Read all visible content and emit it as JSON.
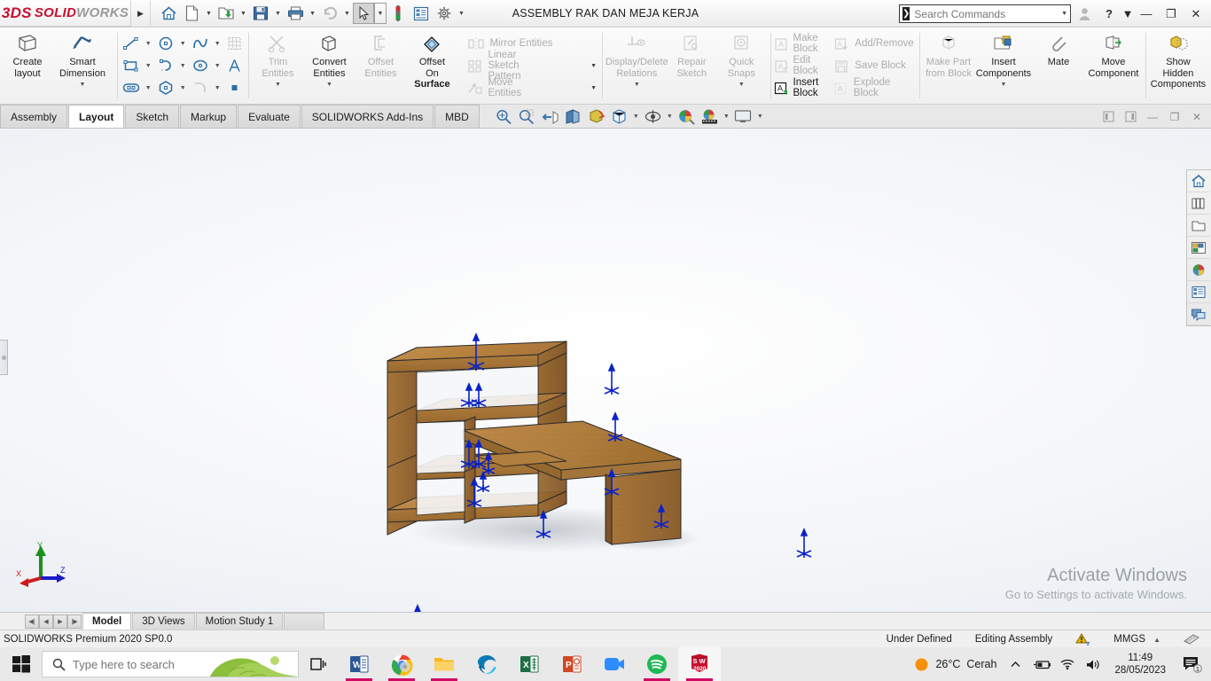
{
  "titlebar": {
    "logo_ds": "3DS",
    "logo_solid": "SOLID",
    "logo_works": "WORKS",
    "document_title": "ASSEMBLY RAK DAN MEJA KERJA",
    "search_placeholder": "Search Commands",
    "icons": [
      "expand-arrow-icon",
      "home-icon",
      "new-document-icon",
      "open-folder-icon",
      "save-icon",
      "print-icon",
      "undo-icon",
      "select-cursor-icon",
      "rebuild-icon",
      "options-list-icon",
      "settings-gear-icon"
    ],
    "window_buttons": [
      "user-account-icon",
      "help-icon",
      "minimize-button",
      "restore-button",
      "close-button"
    ]
  },
  "ribbon": {
    "groups": [
      {
        "name": "layout",
        "buttons": [
          {
            "label": "Create\nlayout",
            "label_l1": "Create",
            "label_l2": "layout",
            "enabled": true,
            "icon": "create-layout-icon"
          },
          {
            "label_l1": "Smart",
            "label_l2": "Dimension",
            "enabled": true,
            "icon": "smart-dimension-icon"
          }
        ]
      },
      {
        "name": "sketch-entities",
        "small_icons": [
          "line-icon",
          "circle-icon",
          "spline-icon",
          "sketch-grid-icon",
          "rectangle-icon",
          "arc-icon",
          "ellipse-icon",
          "text-icon",
          "slot-icon",
          "polygon-icon",
          "fillet-icon",
          "point-icon"
        ]
      },
      {
        "name": "sketch-tools",
        "buttons": [
          {
            "label_l1": "Trim",
            "label_l2": "Entities",
            "enabled": false,
            "icon": "trim-entities-icon"
          },
          {
            "label_l1": "Convert",
            "label_l2": "Entities",
            "enabled": true,
            "icon": "convert-entities-icon"
          },
          {
            "label_l1": "Offset",
            "label_l2": "Entities",
            "enabled": false,
            "icon": "offset-entities-icon"
          },
          {
            "label_l1": "Offset",
            "label_l2": "On",
            "label_l3": "Surface",
            "enabled": true,
            "icon": "offset-on-surface-icon"
          }
        ]
      },
      {
        "name": "pattern-tools",
        "items": [
          {
            "label": "Mirror Entities",
            "enabled": false,
            "icon": "mirror-entities-icon",
            "has_caret": false
          },
          {
            "label": "Linear Sketch Pattern",
            "enabled": false,
            "icon": "linear-sketch-pattern-icon",
            "has_caret": true
          },
          {
            "label": "Move Entities",
            "enabled": false,
            "icon": "move-entities-icon",
            "has_caret": true
          }
        ]
      },
      {
        "name": "relations",
        "buttons": [
          {
            "label_l1": "Display/Delete",
            "label_l2": "Relations",
            "enabled": false,
            "icon": "display-delete-relations-icon"
          },
          {
            "label_l1": "Repair",
            "label_l2": "Sketch",
            "enabled": false,
            "icon": "repair-sketch-icon"
          },
          {
            "label_l1": "Quick",
            "label_l2": "Snaps",
            "enabled": false,
            "icon": "quick-snaps-icon"
          }
        ]
      },
      {
        "name": "blocks",
        "items": [
          {
            "label": "Make Block",
            "enabled": false,
            "icon": "make-block-icon"
          },
          {
            "label": "Edit Block",
            "enabled": false,
            "icon": "edit-block-icon"
          },
          {
            "label": "Insert Block",
            "enabled": true,
            "icon": "insert-block-icon"
          },
          {
            "label": "Add/Remove",
            "enabled": false,
            "icon": "add-remove-block-icon"
          },
          {
            "label": "Save Block",
            "enabled": false,
            "icon": "save-block-icon"
          },
          {
            "label": "Explode Block",
            "enabled": false,
            "icon": "explode-block-icon"
          }
        ]
      },
      {
        "name": "components",
        "buttons": [
          {
            "label_l1": "Make Part",
            "label_l2": "from Block",
            "enabled": false,
            "icon": "make-part-from-block-icon"
          },
          {
            "label_l1": "Insert",
            "label_l2": "Components",
            "enabled": true,
            "icon": "insert-components-icon"
          },
          {
            "label_l1": "Mate",
            "enabled": true,
            "icon": "mate-icon"
          },
          {
            "label_l1": "Move",
            "label_l2": "Component",
            "enabled": true,
            "icon": "move-component-icon"
          },
          {
            "label_l1": "Show",
            "label_l2": "Hidden",
            "label_l3": "Components",
            "enabled": true,
            "icon": "show-hidden-components-icon"
          }
        ]
      }
    ]
  },
  "tabs": {
    "items": [
      {
        "label": "Assembly",
        "active": false
      },
      {
        "label": "Layout",
        "active": true
      },
      {
        "label": "Sketch",
        "active": false
      },
      {
        "label": "Markup",
        "active": false
      },
      {
        "label": "Evaluate",
        "active": false
      },
      {
        "label": "SOLIDWORKS Add-Ins",
        "active": false
      },
      {
        "label": "MBD",
        "active": false
      }
    ],
    "view_tools": [
      "zoom-to-fit-icon",
      "zoom-to-area-icon",
      "previous-view-icon",
      "section-view-icon",
      "view-orientation-icon",
      "display-style-icon",
      "hide-show-items-icon",
      "edit-appearance-icon",
      "apply-scene-icon",
      "view-settings-icon"
    ],
    "doc_controls": [
      "pin-left-icon",
      "pin-right-icon",
      "doc-minimize-button",
      "doc-restore-button",
      "doc-close-button"
    ]
  },
  "graphics": {
    "model_name": "rak-dan-meja-kerja-assembly",
    "watermark_line1": "Activate Windows",
    "watermark_line2": "Go to Settings to activate Windows.",
    "triad_axes": [
      "X",
      "Y",
      "Z"
    ],
    "task_pane_icons": [
      "sw-resources-home-icon",
      "design-library-icon",
      "file-explorer-icon",
      "view-palette-icon",
      "appearances-scenes-icon",
      "custom-properties-icon",
      "solidworks-forum-icon"
    ]
  },
  "bottom": {
    "nav_buttons": [
      "first-tab-icon",
      "prev-tab-icon",
      "next-tab-icon",
      "last-tab-icon"
    ],
    "tabs": [
      {
        "label": "Model",
        "active": true
      },
      {
        "label": "3D Views",
        "active": false
      },
      {
        "label": "Motion Study 1",
        "active": false
      }
    ]
  },
  "statusbar": {
    "version": "SOLIDWORKS Premium 2020 SP0.0",
    "state": "Under Defined",
    "mode": "Editing Assembly",
    "warning_icon": "overdefined-warning-icon",
    "units": "MMGS",
    "units_caret": "▲",
    "editor_icon": "unit-system-editor-icon"
  },
  "taskbar": {
    "start_icon": "windows-start-icon",
    "search_placeholder": "Type here to search",
    "taskview_icon": "task-view-icon",
    "apps": [
      {
        "name": "word-taskbar-icon",
        "letter": "W",
        "active": false,
        "running": true
      },
      {
        "name": "chrome-taskbar-icon",
        "letter": "",
        "active": false,
        "running": true
      },
      {
        "name": "file-explorer-taskbar-icon",
        "letter": "",
        "active": false,
        "running": true
      },
      {
        "name": "edge-taskbar-icon",
        "letter": "",
        "active": false,
        "running": false
      },
      {
        "name": "excel-taskbar-icon",
        "letter": "X",
        "active": false,
        "running": false
      },
      {
        "name": "powerpoint-taskbar-icon",
        "letter": "P",
        "active": false,
        "running": false
      },
      {
        "name": "zoom-taskbar-icon",
        "letter": "",
        "active": false,
        "running": false
      },
      {
        "name": "spotify-taskbar-icon",
        "letter": "",
        "active": false,
        "running": true
      },
      {
        "name": "solidworks-taskbar-icon",
        "letter": "SW",
        "sub": "2020",
        "active": true,
        "running": true
      }
    ],
    "tray": {
      "weather_temp": "26°C",
      "weather_desc": "Cerah",
      "chevron": "^",
      "icons": [
        "battery-icon",
        "wifi-icon",
        "volume-icon"
      ],
      "time": "11:49",
      "date": "28/05/2023",
      "notification_count": "1"
    }
  },
  "colors": {
    "accent_red": "#c8102e",
    "wood_light": "#c08a4a",
    "wood_mid": "#a9713a",
    "wood_dark": "#8a5a2c",
    "triad_blue": "#0b22c8",
    "taskbar_bg": "#e9e9e9"
  }
}
